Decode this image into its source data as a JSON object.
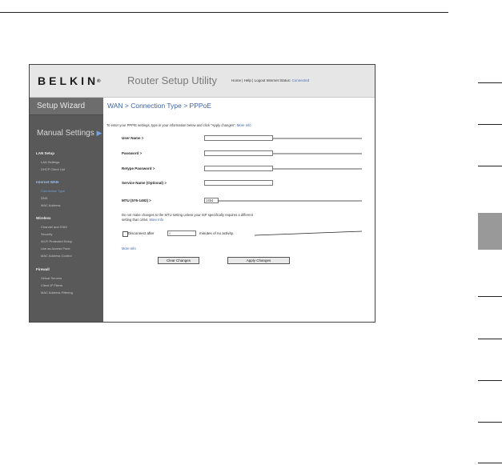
{
  "router": {
    "brand": "BELKIN",
    "brand_mark": "®",
    "util_title": "Router Setup Utility",
    "hdr_links": "Home | Help | Logout",
    "status_label": "Internet Status:",
    "status_value": "Connected",
    "sidebar": {
      "wizard": "Setup Wizard",
      "manual": "Manual Settings",
      "manual_arrow": "▶",
      "lan_group": "LAN Setup",
      "lan_items": [
        "LAN Settings",
        "DHCP Client List"
      ],
      "internet_group": "Internet WAN",
      "internet_items": [
        "Connection Type",
        "DNS",
        "MAC Address"
      ],
      "wireless_group": "Wireless",
      "wireless_items": [
        "Channel and SSID",
        "Security",
        "Wi-Fi Protected Setup",
        "Use as Access Point",
        "MAC Address Control"
      ],
      "firewall_group": "Firewall",
      "firewall_items": [
        "Virtual Servers",
        "Client IP Filters",
        "MAC Address Filtering"
      ]
    },
    "page_title": "WAN > Connection Type > PPPoE",
    "intro_text": "To enter your PPP/E settings, type in your information below and click \"Apply changes\".",
    "intro_link": "More Info",
    "fields": {
      "user_name": "User Name >",
      "password": "Password >",
      "retype_password": "Retype Password >",
      "service_name": "Service Name (Optional) >",
      "mtu": "MTU (576-1492) >",
      "mtu_value": "1454"
    },
    "mtu_note_1": "Do not make changes to the MTU setting unless your ISP specifically requires a different",
    "mtu_note_2": "setting than 1454.",
    "mtu_note_link": "More Info",
    "disconnect_label": "Disconnect after",
    "disconnect_value": "0",
    "disconnect_tail": "minutes of no activity.",
    "more_info": "More Info",
    "clear_button": "Clear Changes",
    "apply_button": "Apply Changes"
  }
}
